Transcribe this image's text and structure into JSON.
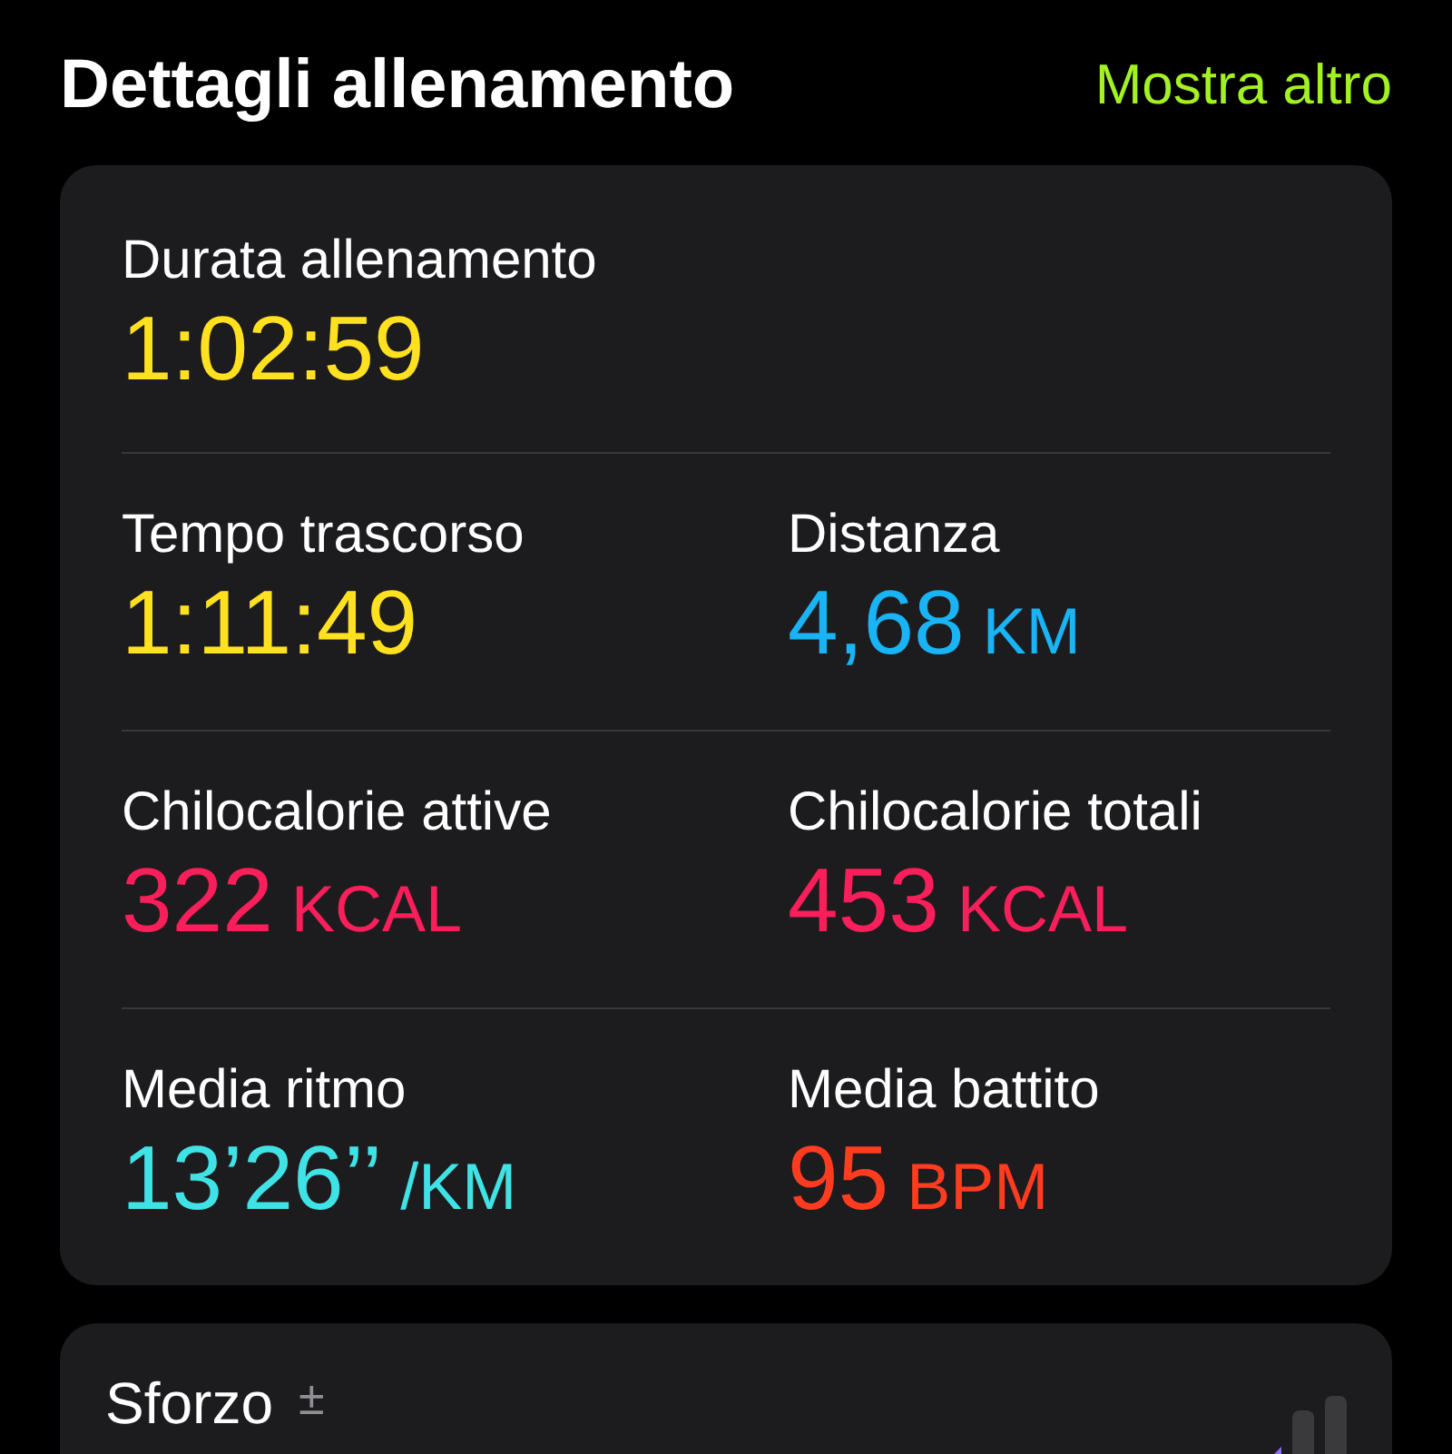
{
  "header": {
    "title": "Dettagli allenamento",
    "action": "Mostra altro"
  },
  "metric_rows": [
    [
      {
        "label": "Durata allenamento",
        "value": "1:02:59",
        "color": "#ffe11f"
      }
    ],
    [
      {
        "label": "Tempo trascorso",
        "value": "1:11:49",
        "color": "#ffe11f"
      },
      {
        "label": "Distanza",
        "value": "4,68",
        "unit": "KM",
        "color": "#18b4f5"
      }
    ],
    [
      {
        "label": "Chilocalorie attive",
        "value": "322",
        "unit": "KCAL",
        "color": "#fa1e5a"
      },
      {
        "label": "Chilocalorie totali",
        "value": "453",
        "unit": "KCAL",
        "color": "#fa1e5a"
      }
    ],
    [
      {
        "label": "Media ritmo",
        "value": "13’26’’",
        "unit": "/KM",
        "color": "#3fe3e6"
      },
      {
        "label": "Media battito",
        "value": "95",
        "unit": "BPM",
        "color": "#ff3b20"
      }
    ]
  ],
  "effort": {
    "title": "Sforzo",
    "symbol": "±"
  }
}
